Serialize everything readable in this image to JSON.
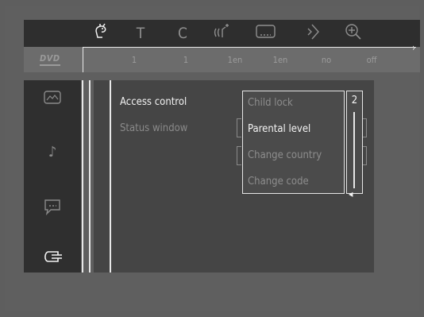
{
  "topbar": {
    "icons": [
      {
        "name": "disc-menu-icon",
        "glyph": "ᘛ",
        "active": true
      },
      {
        "name": "title-icon",
        "glyph": "T",
        "active": false
      },
      {
        "name": "chapter-icon",
        "glyph": "C",
        "active": false
      },
      {
        "name": "audio-icon",
        "glyph": "((⸢",
        "active": false
      },
      {
        "name": "subtitle-icon",
        "glyph": "▭",
        "active": false
      },
      {
        "name": "angle-icon",
        "glyph": "◇",
        "active": false
      },
      {
        "name": "zoom-icon",
        "glyph": "⊕",
        "active": false
      }
    ],
    "values": [
      "1",
      "1",
      "1en",
      "1en",
      "no",
      "off"
    ],
    "logo": "DVD"
  },
  "sidebar": {
    "icons": [
      {
        "name": "picture-icon",
        "glyph": "⌇"
      },
      {
        "name": "sound-icon",
        "glyph": "♪"
      },
      {
        "name": "language-icon",
        "glyph": "▭"
      },
      {
        "name": "features-icon",
        "glyph": "⊂⊃"
      }
    ]
  },
  "menu": {
    "items": [
      "Access control",
      "Status window"
    ]
  },
  "submenu": {
    "items": [
      "Child lock",
      "Parental level",
      "Change country",
      "Change code"
    ]
  },
  "level": {
    "value": "2"
  }
}
